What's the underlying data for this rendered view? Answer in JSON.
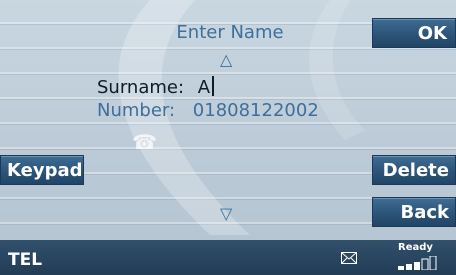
{
  "screen": {
    "title": "Enter Name",
    "fields": {
      "surname_label": "Surname:",
      "surname_value": "A",
      "number_label": "Number:",
      "number_value": "01808122002"
    }
  },
  "buttons": {
    "ok": "OK",
    "keypad": "Keypad",
    "delete": "Delete",
    "back": "Back"
  },
  "statusbar": {
    "mode": "TEL",
    "status": "Ready",
    "signal_bars": 3
  },
  "icons": [
    "up-arrow-icon",
    "down-arrow-icon",
    "phone-icon",
    "envelope-icon",
    "signal-icon"
  ],
  "colors": {
    "button_bg": "#2c5479",
    "accent_text": "#3e6f9a",
    "statusbar_bg": "#2a4660"
  }
}
